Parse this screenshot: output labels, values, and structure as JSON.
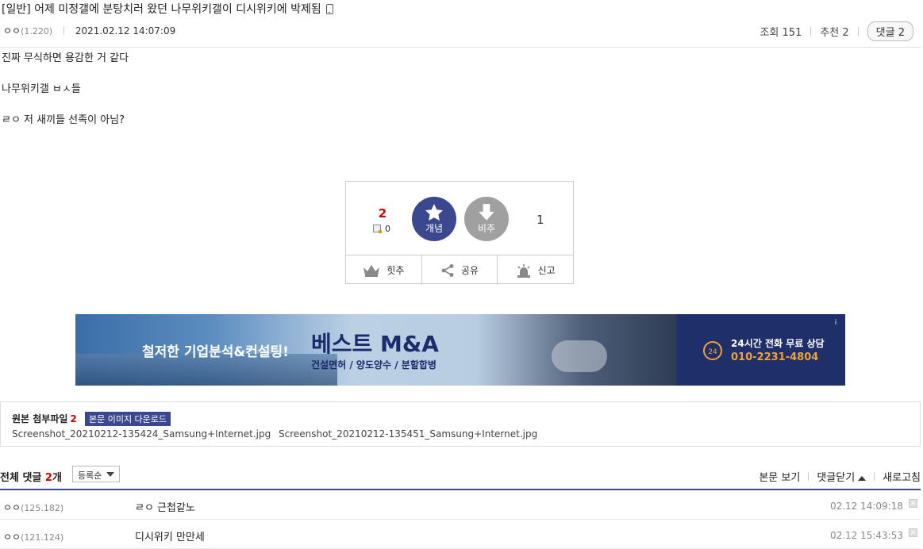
{
  "post": {
    "title": "[일반] 어제 미정갤에 분탕치러 왔던 나무위키갤이 디시위키에 박제됨",
    "writer_nick": "ㅇㅇ",
    "writer_ip": "(1.220)",
    "date": "2021.02.12 14:07:09",
    "views_label": "조회 151",
    "recommend_label": "추천 2",
    "comment_button": "댓글 2",
    "content_lines": [
      "진짜 무식하면 용감한 거 같다",
      "나무위키갤 ㅂㅅ들",
      "ㄹㅇ 저 새끼들 선족이 아님?"
    ]
  },
  "vote": {
    "up_count": "2",
    "fix_count": "0",
    "up_label": "개념",
    "down_label": "비추",
    "down_count": "1",
    "actions": [
      "힛추",
      "공유",
      "신고"
    ]
  },
  "ad": {
    "tagline": "철저한 기업분석&컨설팅!",
    "brand": "베스트 M&A",
    "services": "건설면허 / 양도양수 / 분할합병",
    "cta_line1": "24시간 전화 무료 상담",
    "cta_line2": "010-2231-4804",
    "ad_mark": "i"
  },
  "attachments": {
    "label": "원본 첨부파일",
    "count": "2",
    "download_button": "본문 이미지 다운로드",
    "files": [
      "Screenshot_20210212-135424_Samsung+Internet.jpg",
      "Screenshot_20210212-135451_Samsung+Internet.jpg"
    ]
  },
  "comments": {
    "total_prefix": "전체 댓글",
    "total_count": "2",
    "total_suffix": "개",
    "sort_selected": "등록순",
    "view_body": "본문 보기",
    "close_comments": "댓글닫기",
    "refresh": "새로고침",
    "items": [
      {
        "nick": "ㅇㅇ",
        "ip": "(125.182)",
        "text": "ㄹㅇ 근첩같노",
        "date": "02.12 14:09:18"
      },
      {
        "nick": "ㅇㅇ",
        "ip": "(121.124)",
        "text": "디시위키 만만세",
        "date": "02.12 15:43:53"
      }
    ]
  },
  "colors": {
    "accent": "#3b4890",
    "up_count": "#cc0000",
    "down_button": "#a0a0a0",
    "ad_dark": "#1f2f6a",
    "ad_orange": "#f2a13a"
  }
}
